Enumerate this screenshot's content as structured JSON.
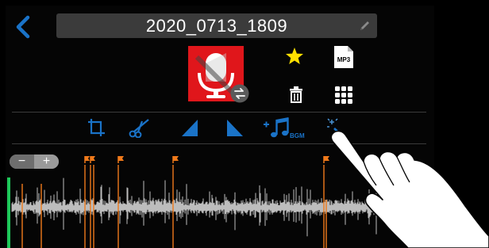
{
  "header": {
    "title": "2020_0713_1809"
  },
  "icons": {
    "back": "back-chevron-icon",
    "edit": "pencil-icon",
    "mic": "microphone-icon",
    "swap": "swap-icon",
    "mark": "star-icon",
    "format": "mp3-icon",
    "delete": "trash-icon",
    "menu": "grid-menu-icon"
  },
  "format_label": "MP3",
  "tools": {
    "trim": "trim-icon",
    "divide": "scissors-icon",
    "fade_in": "fade-in-icon",
    "fade_out": "fade-out-icon",
    "bgm": "add-bgm-icon",
    "effect": "magic-wand-icon"
  },
  "bgm_label": "BGM",
  "zoom": {
    "minus": "−",
    "plus": "+"
  },
  "colors": {
    "accent": "#1a73c8",
    "record_red": "#e0161b",
    "marker_orange": "#f07a1a",
    "star_yellow": "#ffe000",
    "playhead_green": "#1ec85a",
    "waveform": "#bdbdbd"
  }
}
